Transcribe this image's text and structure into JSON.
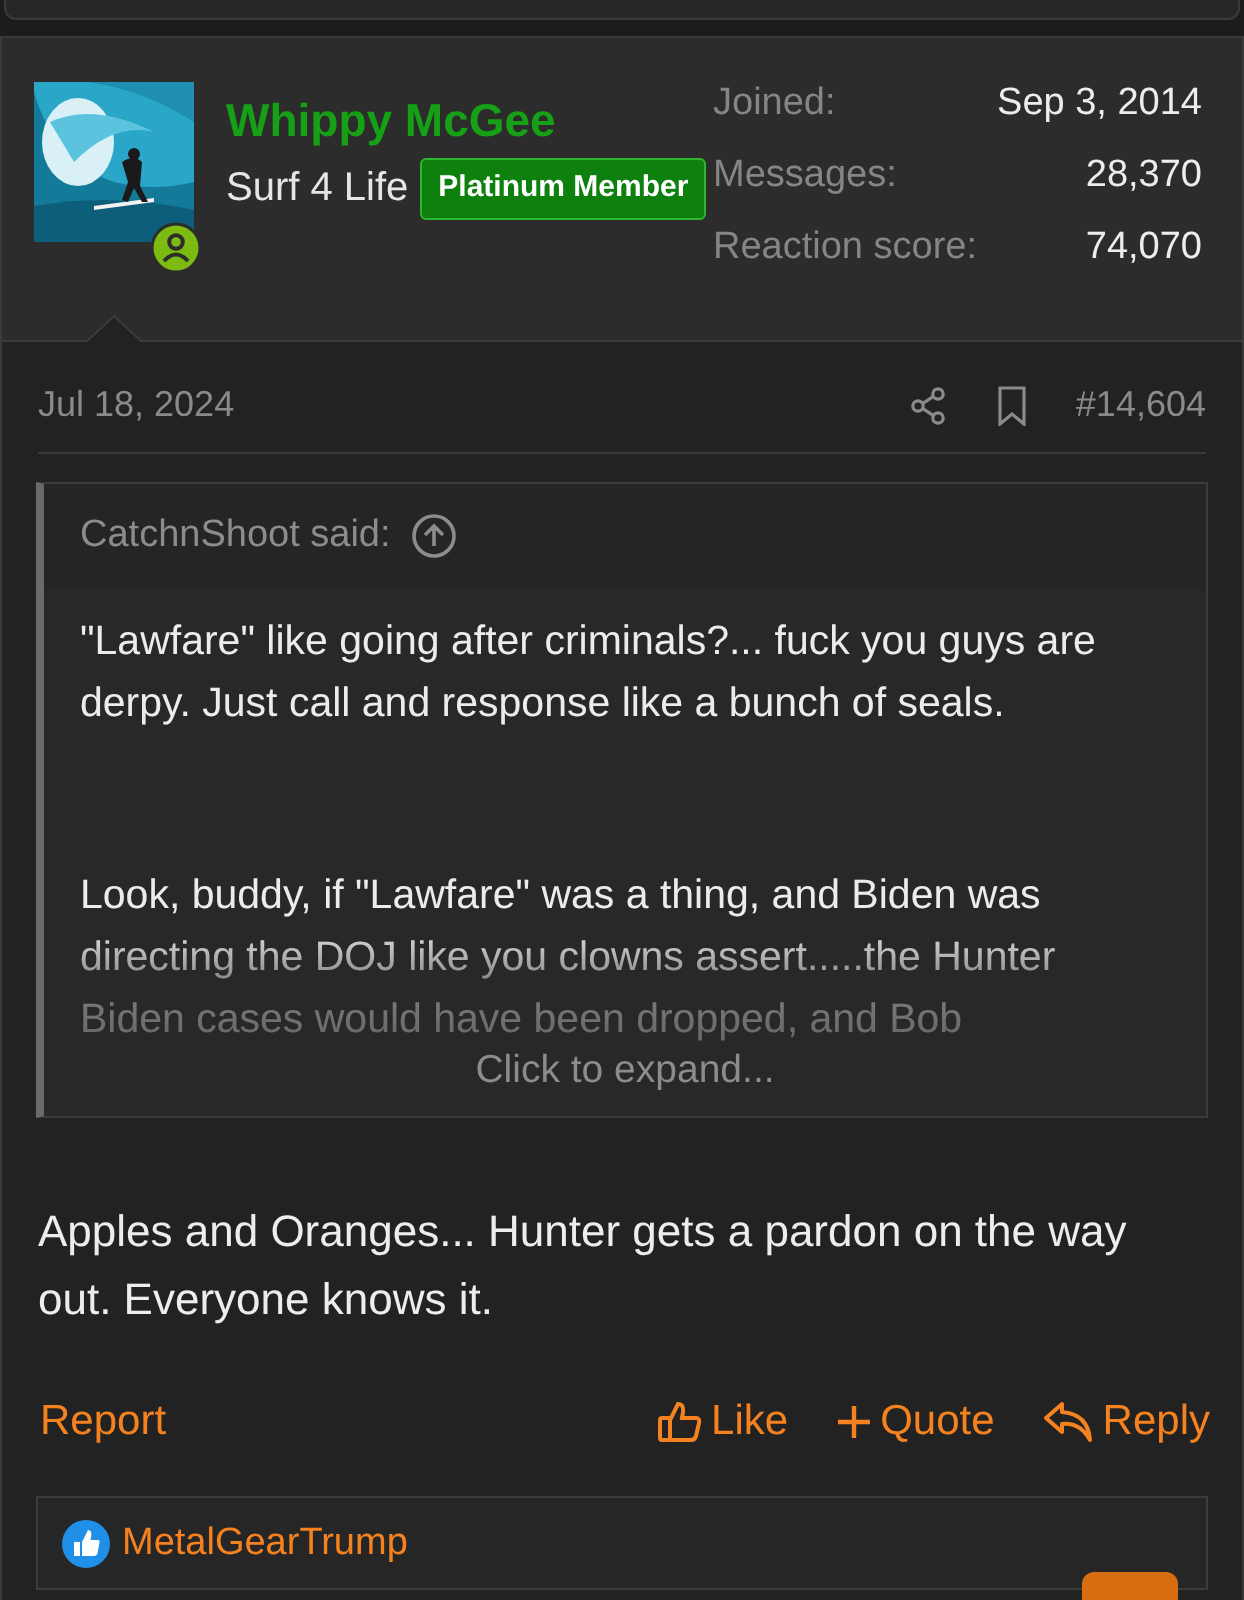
{
  "post": {
    "author": {
      "name": "Whippy McGee",
      "title": "Surf 4 Life",
      "banner": "Platinum Member",
      "online": true
    },
    "stats": [
      {
        "label": "Joined:",
        "value": "Sep 3, 2014"
      },
      {
        "label": "Messages:",
        "value": "28,370"
      },
      {
        "label": "Reaction score:",
        "value": "74,070"
      }
    ],
    "date": "Jul 18, 2024",
    "number": "#14,604",
    "quote": {
      "attribution": "CatchnShoot said:",
      "paragraphs": [
        "\"Lawfare\" like going after criminals?... fuck you guys are derpy. Just call and response like a bunch of seals.",
        "Look, buddy, if \"Lawfare\" was a thing, and Biden was directing the DOJ like you clowns assert.....the Hunter Biden cases would have been dropped, and Bob"
      ],
      "expand": "Click to expand..."
    },
    "message": "Apples and Oranges... Hunter gets a pardon on the way out. Everyone knows it.",
    "report": "Report",
    "actions": [
      {
        "kind": "like",
        "label": "Like"
      },
      {
        "kind": "quote",
        "label": "Quote"
      },
      {
        "kind": "reply",
        "label": "Reply"
      }
    ],
    "reactions": [
      "MetalGearTrump"
    ]
  }
}
